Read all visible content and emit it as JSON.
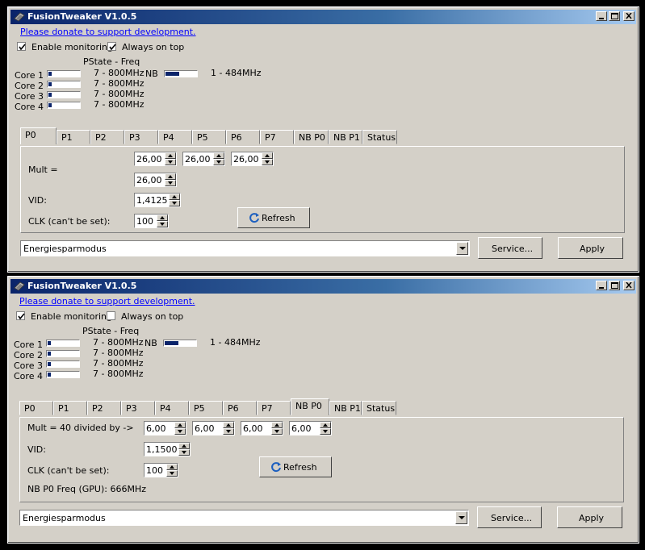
{
  "windows": [
    {
      "title": "FusionTweaker V1.0.5",
      "donate_link": "Please donate to support development.",
      "enable_monitoring": {
        "label": "Enable monitoring",
        "checked": true
      },
      "always_on_top": {
        "label": "Always on top",
        "checked": true
      },
      "pstate_header": "PState - Freq",
      "cores": [
        {
          "label": "Core 1",
          "freq": "7 - 800MHz",
          "load": 0.1
        },
        {
          "label": "Core 2",
          "freq": "7 - 800MHz",
          "load": 0.1
        },
        {
          "label": "Core 3",
          "freq": "7 - 800MHz",
          "load": 0.1
        },
        {
          "label": "Core 4",
          "freq": "7 - 800MHz",
          "load": 0.1
        }
      ],
      "nb": {
        "label": "NB",
        "freq": "1 - 484MHz",
        "load": 1.0
      },
      "tabs": [
        "P0",
        "P1",
        "P2",
        "P3",
        "P4",
        "P5",
        "P6",
        "P7",
        "NB P0",
        "NB P1",
        "Status"
      ],
      "active_tab": "P0",
      "mult_label": "Mult =",
      "mult_values": [
        "26,00",
        "26,00",
        "26,00",
        "26,00"
      ],
      "vid_label": "VID:",
      "vid_value": "1,4125",
      "clk_label": "CLK (can't be set):",
      "clk_value": "100",
      "refresh_label": "Refresh",
      "mode_select": "Energiesparmodus",
      "service_label": "Service...",
      "apply_label": "Apply"
    },
    {
      "title": "FusionTweaker V1.0.5",
      "donate_link": "Please donate to support development.",
      "enable_monitoring": {
        "label": "Enable monitoring",
        "checked": true
      },
      "always_on_top": {
        "label": "Always on top",
        "checked": false
      },
      "pstate_header": "PState - Freq",
      "cores": [
        {
          "label": "Core 1",
          "freq": "7 - 800MHz",
          "load": 0.1
        },
        {
          "label": "Core 2",
          "freq": "7 - 800MHz",
          "load": 0.1
        },
        {
          "label": "Core 3",
          "freq": "7 - 800MHz",
          "load": 0.1
        },
        {
          "label": "Core 4",
          "freq": "7 - 800MHz",
          "load": 0.1
        }
      ],
      "nb": {
        "label": "NB",
        "freq": "1 - 484MHz",
        "load": 1.0
      },
      "tabs": [
        "P0",
        "P1",
        "P2",
        "P3",
        "P4",
        "P5",
        "P6",
        "P7",
        "NB P0",
        "NB P1",
        "Status"
      ],
      "active_tab": "NB P0",
      "mult_label": "Mult = 40 divided by ->",
      "mult_values": [
        "6,00",
        "6,00",
        "6,00",
        "6,00"
      ],
      "vid_label": "VID:",
      "vid_value": "1,1500",
      "clk_label": "CLK (can't be set):",
      "clk_value": "100",
      "refresh_label": "Refresh",
      "nb_freq_text": "NB P0 Freq (GPU): 666MHz",
      "mode_select": "Energiesparmodus",
      "service_label": "Service...",
      "apply_label": "Apply"
    }
  ]
}
